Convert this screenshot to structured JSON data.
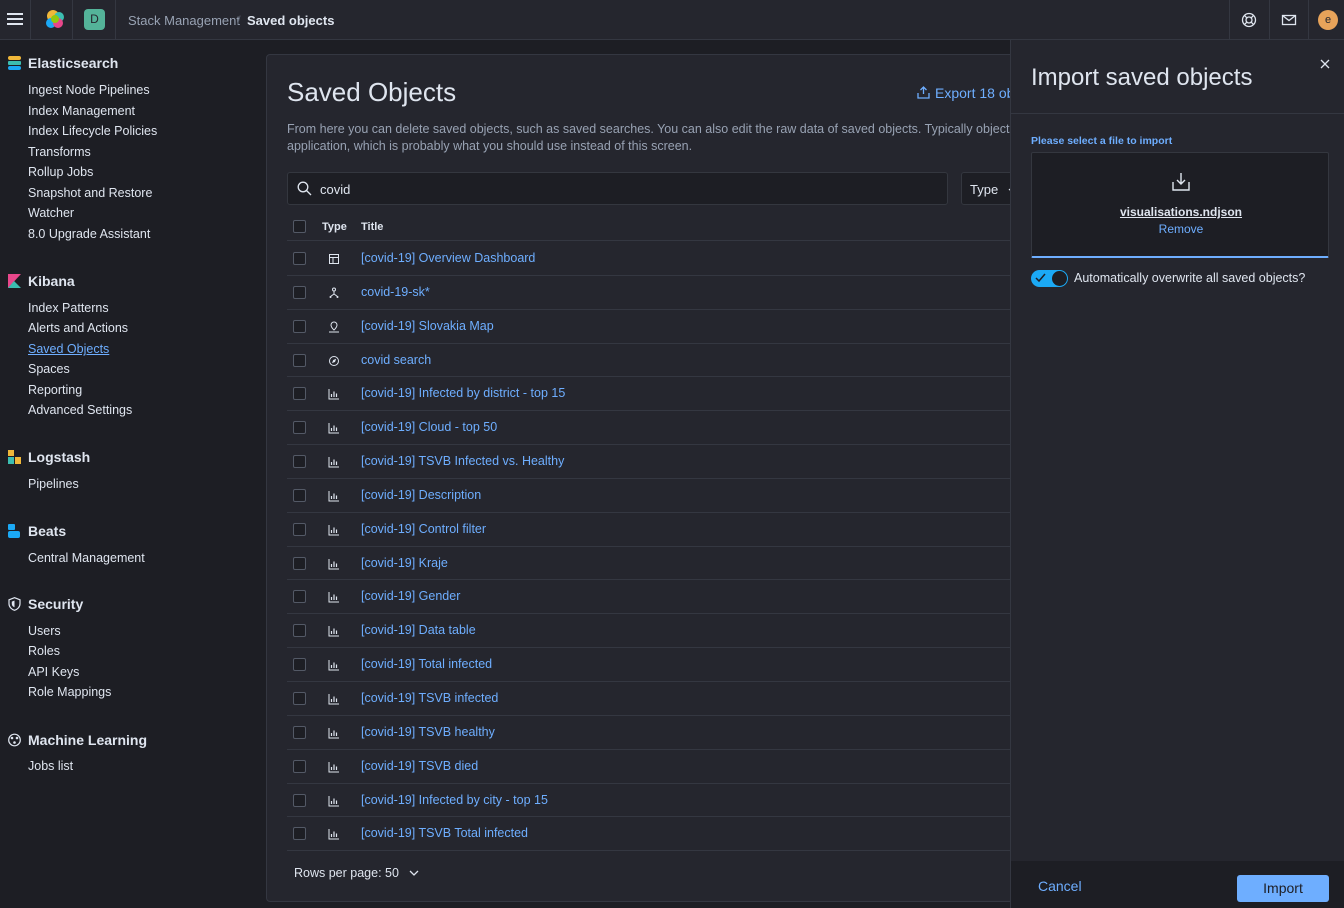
{
  "header": {
    "space_initial": "D",
    "breadcrumbs": [
      "Stack Management",
      "Saved objects"
    ],
    "breadcrumb_separator": "/",
    "user_initial": "e"
  },
  "sidebar": {
    "sections": [
      {
        "title": "Elasticsearch",
        "icon": "elasticsearch-icon",
        "items": [
          "Ingest Node Pipelines",
          "Index Management",
          "Index Lifecycle Policies",
          "Transforms",
          "Rollup Jobs",
          "Snapshot and Restore",
          "Watcher",
          "8.0 Upgrade Assistant"
        ]
      },
      {
        "title": "Kibana",
        "icon": "kibana-icon",
        "items": [
          "Index Patterns",
          "Alerts and Actions",
          "Saved Objects",
          "Spaces",
          "Reporting",
          "Advanced Settings"
        ]
      },
      {
        "title": "Logstash",
        "icon": "logstash-icon",
        "items": [
          "Pipelines"
        ]
      },
      {
        "title": "Beats",
        "icon": "beats-icon",
        "items": [
          "Central Management"
        ]
      },
      {
        "title": "Security",
        "icon": "security-icon",
        "items": [
          "Users",
          "Roles",
          "API Keys",
          "Role Mappings"
        ]
      },
      {
        "title": "Machine Learning",
        "icon": "machine-learning-icon",
        "items": [
          "Jobs list"
        ]
      }
    ],
    "active_item": "Saved Objects"
  },
  "main": {
    "title": "Saved Objects",
    "export_label": "Export 18 ob",
    "description_line1": "From here you can delete saved objects, such as saved searches. You can also edit the raw data of saved objects. Typically objects are",
    "description_line2": "application, which is probably what you should use instead of this screen.",
    "search_value": "covid",
    "type_filter_label": "Type",
    "columns": {
      "type": "Type",
      "title": "Title"
    },
    "rows": [
      {
        "type": "dashboard",
        "title": "[covid-19] Overview Dashboard"
      },
      {
        "type": "index-pattern",
        "title": "covid-19-sk*"
      },
      {
        "type": "map",
        "title": "[covid-19] Slovakia Map"
      },
      {
        "type": "search",
        "title": "covid search"
      },
      {
        "type": "visualization",
        "title": "[covid-19] Infected by district - top 15"
      },
      {
        "type": "visualization",
        "title": "[covid-19] Cloud - top 50"
      },
      {
        "type": "visualization",
        "title": "[covid-19] TSVB Infected vs. Healthy"
      },
      {
        "type": "visualization",
        "title": "[covid-19] Description"
      },
      {
        "type": "visualization",
        "title": "[covid-19] Control filter"
      },
      {
        "type": "visualization",
        "title": "[covid-19] Kraje"
      },
      {
        "type": "visualization",
        "title": "[covid-19] Gender"
      },
      {
        "type": "visualization",
        "title": "[covid-19] Data table"
      },
      {
        "type": "visualization",
        "title": "[covid-19] Total infected"
      },
      {
        "type": "visualization",
        "title": "[covid-19] TSVB infected"
      },
      {
        "type": "visualization",
        "title": "[covid-19] TSVB healthy"
      },
      {
        "type": "visualization",
        "title": "[covid-19] TSVB died"
      },
      {
        "type": "visualization",
        "title": "[covid-19] Infected by city - top 15"
      },
      {
        "type": "visualization",
        "title": "[covid-19] TSVB Total infected"
      }
    ],
    "rows_per_page_label": "Rows per page: 50"
  },
  "flyout": {
    "title": "Import saved objects",
    "file_label": "Please select a file to import",
    "file_name": "visualisations.ndjson",
    "remove_label": "Remove",
    "overwrite_label": "Automatically overwrite all saved objects?",
    "overwrite_enabled": true,
    "cancel_label": "Cancel",
    "import_label": "Import"
  },
  "colors": {
    "accent": "#6eaeff",
    "background": "#1d1e24",
    "panel": "#25262e",
    "toggle_on": "#1ba9f5"
  }
}
